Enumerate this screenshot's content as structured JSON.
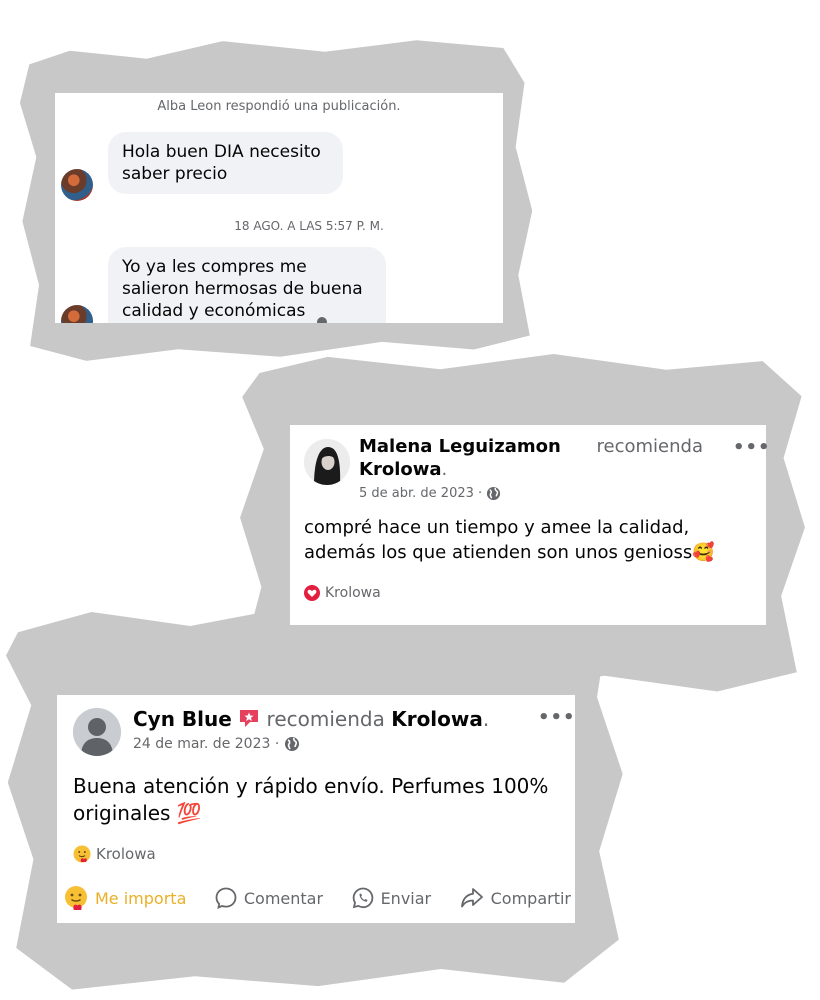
{
  "messenger": {
    "notice": "Alba Leon respondió una publicación.",
    "bubble1": "Hola buen DIA necesito saber precio",
    "timestamp": "18 AGO. A LAS 5:57 P. M.",
    "bubble2": "Yo ya les compres me salieron hermosas de buena calidad y económicas"
  },
  "post1": {
    "author": "Malena Leguizamon",
    "action": "recomienda",
    "page": "Krolowa",
    "date": "5 de abr. de 2023 ·",
    "body": "compré hace un tiempo y amee la calidad, además los que atienden son unos genioss🥰",
    "tag": "Krolowa",
    "tag_icon": "red-heart-icon",
    "menu": "•••"
  },
  "post2": {
    "author": "Cyn Blue",
    "badge_icon": "rising-star-badge-icon",
    "action": "recomienda",
    "page": "Krolowa",
    "date": "24 de mar. de 2023 ·",
    "body_line1": "Buena atención y rápido envío. Perfumes 100%",
    "body_line2": "originales",
    "emoji": "💯",
    "tag": "Krolowa",
    "menu": "•••",
    "actions": {
      "care": "Me importa",
      "comment": "Comentar",
      "send": "Enviar",
      "share": "Compartir"
    }
  },
  "colors": {
    "brush": "#c8c8c8",
    "bubble": "#f0f2f5",
    "secondary_text": "#65676b",
    "care_reaction": "#eab026",
    "heart": "#e41e3f"
  }
}
